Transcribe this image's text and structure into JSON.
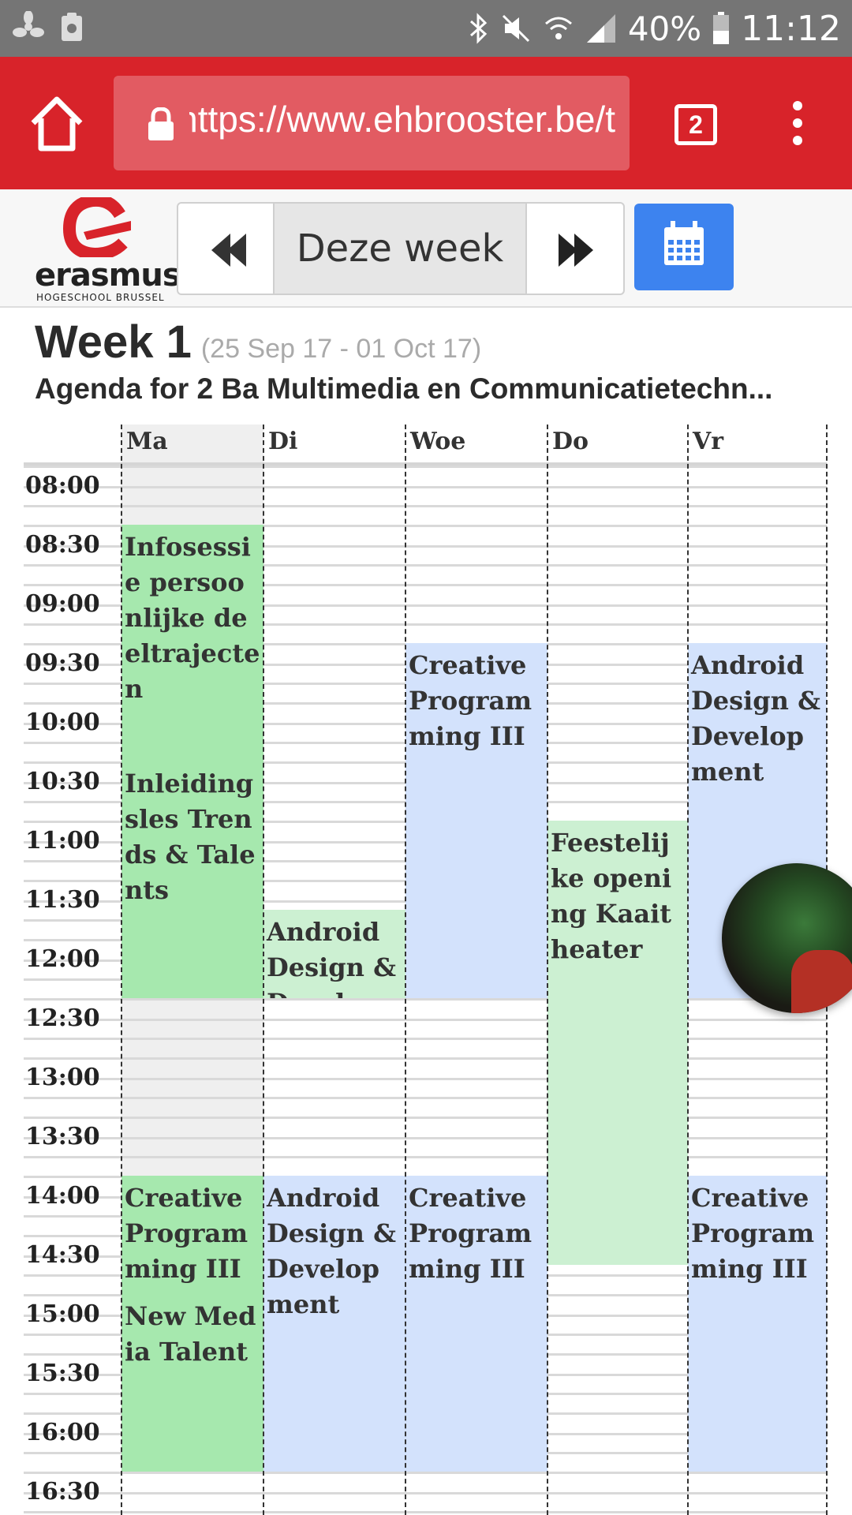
{
  "status_bar": {
    "battery_percent": "40%",
    "time": "11:12"
  },
  "browser": {
    "url": "https://www.ehbrooster.be/t",
    "tab_count": "2"
  },
  "toolbar": {
    "logo_word": "erasmus",
    "logo_sub": "HOGESCHOOL  BRUSSEL",
    "this_week_label": "Deze week"
  },
  "header": {
    "week_title": "Week 1",
    "date_range": "(25 Sep 17 - 01 Oct 17)",
    "agenda_title": "Agenda for 2 Ba Multimedia en Communicatietechn..."
  },
  "days": [
    "Ma",
    "Di",
    "Woe",
    "Do",
    "Vr"
  ],
  "times": [
    "08:00",
    "08:30",
    "09:00",
    "09:30",
    "10:00",
    "10:30",
    "11:00",
    "11:30",
    "12:00",
    "12:30",
    "13:00",
    "13:30",
    "14:00",
    "14:30",
    "15:00",
    "15:30",
    "16:00",
    "16:30"
  ],
  "events": [
    {
      "day": "Ma",
      "start": "08:30",
      "end": "10:30",
      "title": "Infosessie persoonlijke deeltrajecten",
      "color": "#a6e8ae"
    },
    {
      "day": "Ma",
      "start": "10:30",
      "end": "12:30",
      "title": "Inleidingsles Trends & Talents",
      "color": "#a6e8ae"
    },
    {
      "day": "Ma",
      "start": "14:00",
      "end": "15:00",
      "title": "Creative Programming III",
      "color": "#a6e8ae"
    },
    {
      "day": "Ma",
      "start": "15:00",
      "end": "16:30",
      "title": "New Media Talent",
      "color": "#a6e8ae"
    },
    {
      "day": "Di",
      "start": "11:45",
      "end": "12:30",
      "title": "Android Design & Development",
      "color": "#ccf0d2"
    },
    {
      "day": "Di",
      "start": "14:00",
      "end": "16:30",
      "title": "Android Design & Development",
      "color": "#d3e2fc"
    },
    {
      "day": "Woe",
      "start": "09:30",
      "end": "12:30",
      "title": "Creative Programming III",
      "color": "#d3e2fc"
    },
    {
      "day": "Woe",
      "start": "14:00",
      "end": "16:30",
      "title": "Creative Programming III",
      "color": "#d3e2fc"
    },
    {
      "day": "Do",
      "start": "11:00",
      "end": "14:45",
      "title": "Feestelijke opening Kaaitheater",
      "color": "#ccf0d2"
    },
    {
      "day": "Vr",
      "start": "09:30",
      "end": "12:30",
      "title": "Android Design & Development",
      "color": "#d3e2fc"
    },
    {
      "day": "Vr",
      "start": "14:00",
      "end": "16:30",
      "title": "Creative Programming III",
      "color": "#d3e2fc"
    }
  ]
}
